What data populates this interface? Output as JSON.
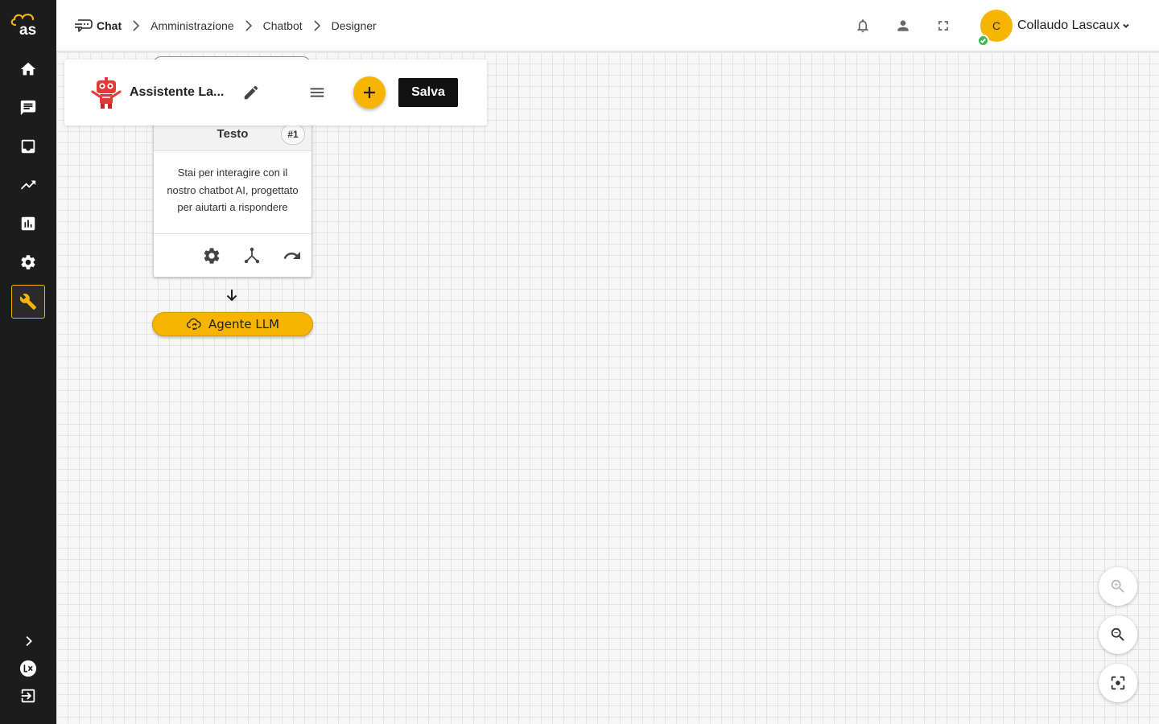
{
  "breadcrumb": {
    "items": [
      "Chat",
      "Amministrazione",
      "Chatbot",
      "Designer"
    ]
  },
  "user": {
    "initial": "C",
    "name": "Collaudo Lascaux",
    "status": "online"
  },
  "bot": {
    "name": "Assistente La..."
  },
  "toolbar": {
    "save_label": "Salva"
  },
  "node": {
    "title": "Testo",
    "badge": "#1",
    "text": "Stai per interagire con il nostro chatbot AI, progettato per aiutarti a rispondere"
  },
  "next_step": {
    "label": "Agente LLM"
  },
  "colors": {
    "accent": "#f7b500",
    "sidebar_bg": "#1c1c1c",
    "save_bg": "#111111",
    "online": "#3fb950"
  },
  "sidebar": {
    "items": [
      "home-icon",
      "chat-icon",
      "inbox-icon",
      "trending-icon",
      "bar-chart-icon",
      "settings-icon",
      "wrench-icon"
    ],
    "active": "wrench-icon"
  }
}
